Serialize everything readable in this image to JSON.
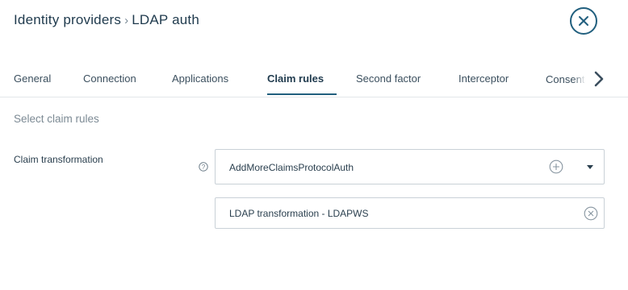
{
  "header": {
    "breadcrumb_parent": "Identity providers",
    "breadcrumb_separator": "›",
    "breadcrumb_current": "LDAP auth",
    "close_icon": "close-icon"
  },
  "tabs": [
    {
      "label": "General"
    },
    {
      "label": "Connection"
    },
    {
      "label": "Applications"
    },
    {
      "label": "Claim rules",
      "active": true
    },
    {
      "label": "Second factor"
    },
    {
      "label": "Interceptor"
    },
    {
      "label": "Consent"
    }
  ],
  "tabs_next_icon": "chevron-right-icon",
  "section": {
    "title": "Select claim rules"
  },
  "claim_transformation": {
    "label": "Claim transformation",
    "help_icon": "help-icon",
    "selected_value": "AddMoreClaimsProtocolAuth",
    "add_icon": "add-circle-icon",
    "dropdown_icon": "caret-down-icon",
    "items": [
      {
        "label": "LDAP transformation - LDAPWS",
        "remove_icon": "remove-circle-icon"
      }
    ]
  },
  "colors": {
    "accent": "#215f7e",
    "text": "#1f3a4d",
    "muted": "#7c8a94",
    "border": "#c9d1d7"
  }
}
